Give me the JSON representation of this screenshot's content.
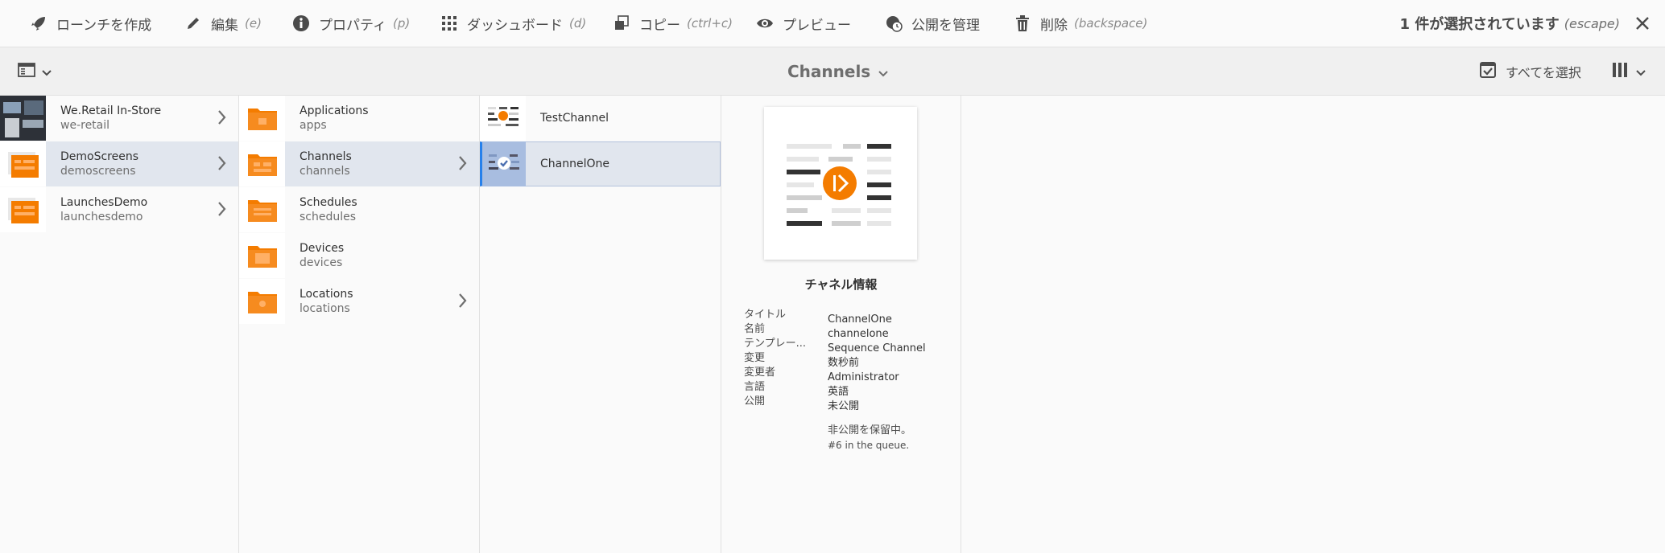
{
  "toolbar": {
    "create_launch": "ローンチを作成",
    "edit_label": "編集",
    "edit_hint": "(e)",
    "properties_label": "プロパティ",
    "properties_hint": "(p)",
    "dashboard_label": "ダッシュボード",
    "dashboard_hint": "(d)",
    "copy_label": "コピー",
    "copy_hint": "(ctrl+c)",
    "preview_label": "プレビュー",
    "manage_publication_label": "公開を管理",
    "delete_label": "削除",
    "delete_hint": "(backspace)",
    "selection_label": "1 件が選択されています",
    "selection_hint": "(escape)"
  },
  "header": {
    "title": "Channels",
    "select_all": "すべてを選択"
  },
  "columns": {
    "sites": [
      {
        "title": "We.Retail In-Store",
        "name": "we-retail"
      },
      {
        "title": "DemoScreens",
        "name": "demoscreens"
      },
      {
        "title": "LaunchesDemo",
        "name": "launchesdemo"
      }
    ],
    "folders": [
      {
        "title": "Applications",
        "name": "apps"
      },
      {
        "title": "Channels",
        "name": "channels"
      },
      {
        "title": "Schedules",
        "name": "schedules"
      },
      {
        "title": "Devices",
        "name": "devices"
      },
      {
        "title": "Locations",
        "name": "locations"
      }
    ],
    "channels": [
      {
        "title": "TestChannel"
      },
      {
        "title": "ChannelOne"
      }
    ]
  },
  "meta": {
    "heading": "チャネル情報",
    "rows": [
      {
        "key": "タイトル",
        "value": "ChannelOne"
      },
      {
        "key": "名前",
        "value": "channelone"
      },
      {
        "key": "テンプレー...",
        "value": "Sequence Channel"
      },
      {
        "key": "変更",
        "value": "数秒前"
      },
      {
        "key": "変更者",
        "value": "Administrator"
      },
      {
        "key": "言語",
        "value": "英語"
      },
      {
        "key": "公開",
        "value": "未公開"
      }
    ],
    "pending": "非公開を保留中。",
    "queue": "#6 in the queue."
  },
  "colors": {
    "accent_orange": "#f47c00",
    "selection_bg": "#e1e6ee",
    "check_blue": "#2680eb"
  }
}
